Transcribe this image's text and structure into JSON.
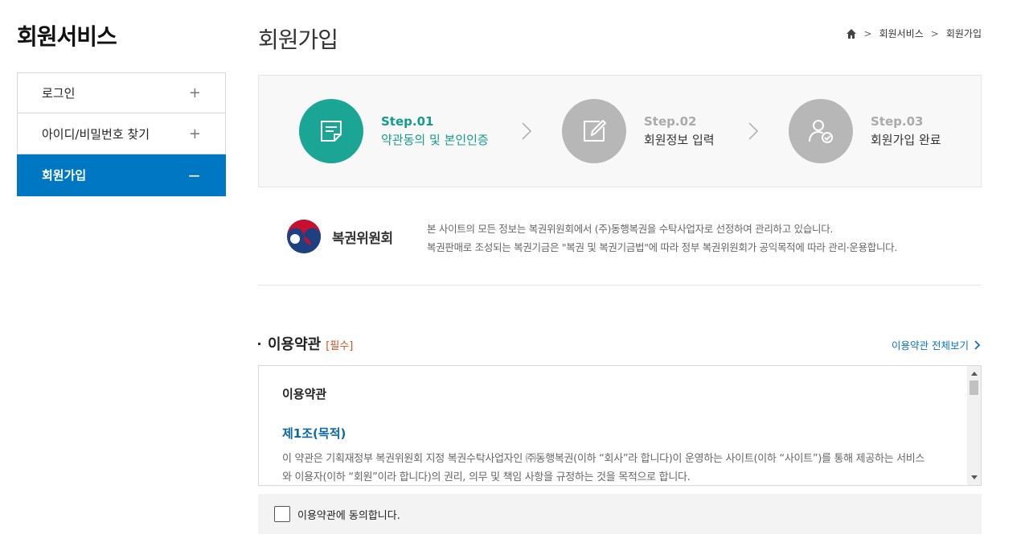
{
  "sidebar": {
    "title": "회원서비스",
    "items": [
      {
        "label": "로그인",
        "toggle": "+"
      },
      {
        "label": "아이디/비밀번호 찾기",
        "toggle": "+"
      },
      {
        "label": "회원가입",
        "toggle": "−"
      }
    ]
  },
  "header": {
    "title": "회원가입",
    "breadcrumb": [
      "회원서비스",
      "회원가입"
    ]
  },
  "steps": [
    {
      "num": "Step.01",
      "label": "약관동의 및 본인인증",
      "icon": "document-icon"
    },
    {
      "num": "Step.02",
      "label": "회원정보 입력",
      "icon": "edit-icon"
    },
    {
      "num": "Step.03",
      "label": "회원가입 완료",
      "icon": "user-check-icon"
    }
  ],
  "info": {
    "logo_text": "복권위원회",
    "line1": "본 사이트의 모든 정보는 복권위원회에서 (주)동행복권을 수탁사업자로 선정하여 관리하고 있습니다.",
    "line2": "복권판매로 조성되는 복권기금은 \"복권 및 복권기금법\"에 따라 정부 복권위원회가 공익목적에 따라 관리·운용합니다."
  },
  "terms": {
    "title": "이용약관",
    "required": "[필수]",
    "view_all": "이용약관 전체보기",
    "content_title": "이용약관",
    "article_title": "제1조(목적)",
    "article_body_1": "이 약관은 기획재정부 복권위원회 지정 복권수탁사업자인 ㈜동행복권(이하 “회사”라 합니다)이 운영하는 사이트(이하 “사이트”)를 통해 제공하는 서비스",
    "article_body_2": "와 이용자(이하 “회원”이라 합니다)의 권리, 의무 및 책임 사항을 규정하는 것을 목적으로 합니다."
  },
  "agree": {
    "label": "이용약관에 동의합니다."
  },
  "colors": {
    "accent_blue": "#0077c2",
    "step_active": "#1aa595",
    "required_red": "#d2521f"
  }
}
